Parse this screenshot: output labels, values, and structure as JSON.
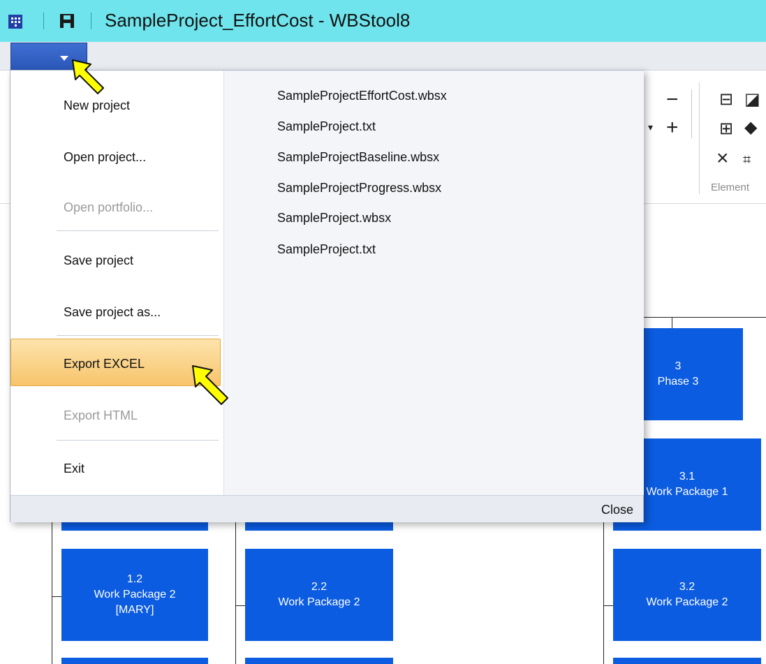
{
  "window": {
    "title": "SampleProject_EffortCost - WBStool8"
  },
  "ribbon": {
    "group_label": "Element",
    "icons": [
      "minus-icon",
      "plus-icon",
      "dropdown-arrow-icon",
      "add-child-icon",
      "edit-icon",
      "add-sibling-icon",
      "milestone-diamond-icon",
      "delete-icon",
      "org-chart-icon"
    ]
  },
  "file_menu": {
    "items": [
      {
        "label": "New project",
        "enabled": true
      },
      {
        "label": "Open project...",
        "enabled": true
      },
      {
        "label": "Open portfolio...",
        "enabled": false
      },
      {
        "label": "Save project",
        "enabled": true
      },
      {
        "label": "Save project as...",
        "enabled": true
      },
      {
        "label": "Export EXCEL",
        "enabled": true,
        "highlighted": true
      },
      {
        "label": "Export HTML",
        "enabled": false
      },
      {
        "label": "Exit",
        "enabled": true
      }
    ],
    "recent_files": [
      "SampleProjectEffortCost.wbsx",
      "SampleProject.txt",
      "SampleProjectBaseline.wbsx",
      "SampleProjectProgress.wbsx",
      "SampleProject.wbsx",
      "SampleProject.txt"
    ],
    "close_label": "Close"
  },
  "wbs": {
    "phase3": {
      "id": "3",
      "name": "Phase 3"
    },
    "wp31": {
      "id": "3.1",
      "name": "Work Package 1"
    },
    "wp12": {
      "id": "1.2",
      "name": "Work Package 2",
      "owner": "[MARY]"
    },
    "wp22": {
      "id": "2.2",
      "name": "Work Package 2"
    },
    "wp32": {
      "id": "3.2",
      "name": "Work Package 2"
    }
  },
  "colors": {
    "titlebar": "#6fe4ec",
    "wbs_box": "#0b5ce0",
    "highlight": "#f7c46a",
    "cursor": "#ffff00"
  }
}
